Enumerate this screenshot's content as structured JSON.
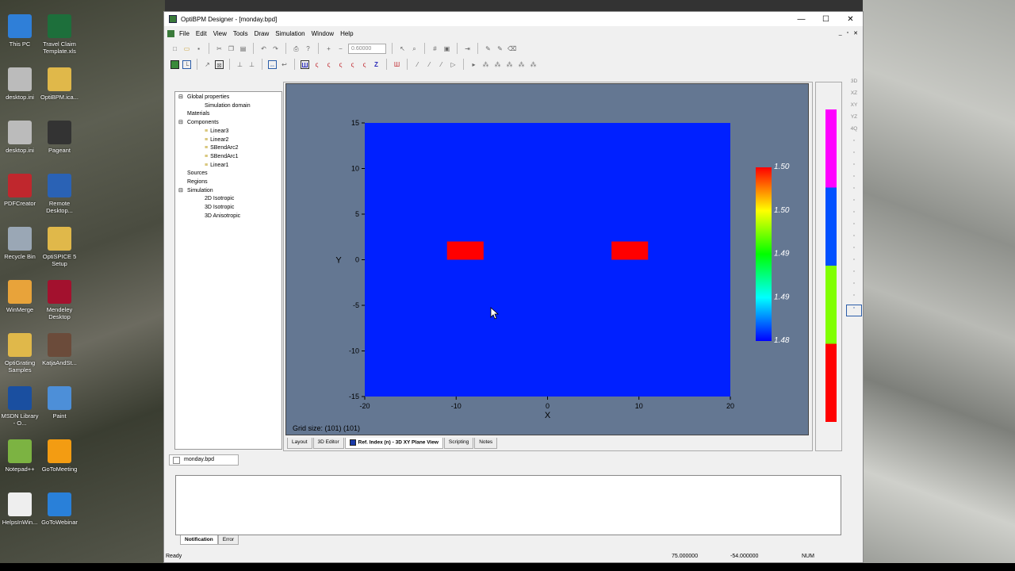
{
  "desktop": {
    "icons": [
      {
        "label": "This PC",
        "color": "#2f7fd8"
      },
      {
        "label": "Travel Claim Template.xls",
        "color": "#1d6f3b"
      },
      {
        "label": "desktop.ini",
        "color": "#bbbbbb"
      },
      {
        "label": "OptiBPM.ica...",
        "color": "#e0b84a"
      },
      {
        "label": "desktop.ini",
        "color": "#bbbbbb"
      },
      {
        "label": "Pageant",
        "color": "#333333"
      },
      {
        "label": "PDFCreator",
        "color": "#c0272d"
      },
      {
        "label": "Remote Desktop...",
        "color": "#2a62b5"
      },
      {
        "label": "Recycle Bin",
        "color": "#9aa7b5"
      },
      {
        "label": "OptiSPICE 5 Setup",
        "color": "#e0b84a"
      },
      {
        "label": "WinMerge",
        "color": "#e8a33a"
      },
      {
        "label": "Mendeley Desktop",
        "color": "#a3112e"
      },
      {
        "label": "OptiGrating Samples",
        "color": "#e0b84a"
      },
      {
        "label": "KatjaAndSt...",
        "color": "#6b4b3a"
      },
      {
        "label": "MSDN Library - O...",
        "color": "#1a4fa0"
      },
      {
        "label": "Paint",
        "color": "#4d8fd8"
      },
      {
        "label": "Notepad++",
        "color": "#7cb342"
      },
      {
        "label": "GoToMeeting",
        "color": "#f39c12"
      },
      {
        "label": "HelpsInWin...",
        "color": "#eeeeee"
      },
      {
        "label": "GoToWebinar",
        "color": "#2980d9"
      }
    ]
  },
  "window": {
    "title": "OptiBPM Designer - [monday.bpd]",
    "controls": {
      "minimize": "—",
      "maximize": "☐",
      "close": "✕"
    }
  },
  "menu": [
    "File",
    "Edit",
    "View",
    "Tools",
    "Draw",
    "Simulation",
    "Window",
    "Help"
  ],
  "mdi_controls": [
    "_",
    "▫",
    "✕"
  ],
  "toolbar": {
    "zoom_value": "0.60000"
  },
  "tree": [
    {
      "label": "Global properties",
      "indent": 0,
      "expander": "⊟"
    },
    {
      "label": "Simulation domain",
      "indent": 1,
      "expander": ""
    },
    {
      "label": "Materials",
      "indent": 0,
      "expander": ""
    },
    {
      "label": "Components",
      "indent": 0,
      "expander": "⊟"
    },
    {
      "label": "Linear3",
      "indent": 1,
      "expander": "",
      "icon": true
    },
    {
      "label": "Linear2",
      "indent": 1,
      "expander": "",
      "icon": true
    },
    {
      "label": "SBendArc2",
      "indent": 1,
      "expander": "",
      "icon": true
    },
    {
      "label": "SBendArc1",
      "indent": 1,
      "expander": "",
      "icon": true
    },
    {
      "label": "Linear1",
      "indent": 1,
      "expander": "",
      "icon": true
    },
    {
      "label": "Sources",
      "indent": 0,
      "expander": ""
    },
    {
      "label": "Regions",
      "indent": 0,
      "expander": ""
    },
    {
      "label": "Simulation",
      "indent": 0,
      "expander": "⊟"
    },
    {
      "label": "2D Isotropic",
      "indent": 1,
      "expander": ""
    },
    {
      "label": "3D Isotropic",
      "indent": 1,
      "expander": ""
    },
    {
      "label": "3D Anisotropic",
      "indent": 1,
      "expander": ""
    }
  ],
  "plot": {
    "xlabel": "X",
    "ylabel": "Y",
    "xticks": [
      "-20",
      "-10",
      "0",
      "10",
      "20"
    ],
    "yticks": [
      "15",
      "10",
      "5",
      "0",
      "-5",
      "-10",
      "-15"
    ],
    "grid_size": "Grid size: (101) (101)",
    "colorbar_labels": [
      "1.50",
      "1.50",
      "1.49",
      "1.49",
      "1.48"
    ]
  },
  "chart_data": {
    "type": "heatmap",
    "xlabel": "X",
    "ylabel": "Y",
    "xlim": [
      -20,
      20
    ],
    "ylim": [
      -15,
      15
    ],
    "background_value": 1.48,
    "regions": [
      {
        "x": [
          -11,
          -7
        ],
        "y": [
          0,
          2
        ],
        "value": 1.5
      },
      {
        "x": [
          7,
          11
        ],
        "y": [
          0,
          2
        ],
        "value": 1.5
      }
    ],
    "colorbar": {
      "min": 1.48,
      "max": 1.5,
      "ticks": [
        "1.50",
        "1.50",
        "1.49",
        "1.49",
        "1.48"
      ]
    }
  },
  "view_tabs": [
    {
      "label": "Layout",
      "active": false
    },
    {
      "label": "3D Editor",
      "active": false
    },
    {
      "label": "Ref. Index (n) - 3D XY Plane View",
      "active": true
    },
    {
      "label": "Scripting",
      "active": false
    },
    {
      "label": "Notes",
      "active": false
    }
  ],
  "palette": [
    "#ff00ff",
    "#0050ff",
    "#80ff00",
    "#ff0000"
  ],
  "right_tools": [
    "3D",
    "XZ",
    "XY",
    "YZ",
    "4Q"
  ],
  "file_tab": "monday.bpd",
  "bottom_tabs": [
    {
      "label": "Notification",
      "active": true
    },
    {
      "label": "Error",
      "active": false
    }
  ],
  "status": {
    "text": "Ready",
    "x": "75.000000",
    "y": "-54.000000",
    "num": "NUM"
  }
}
